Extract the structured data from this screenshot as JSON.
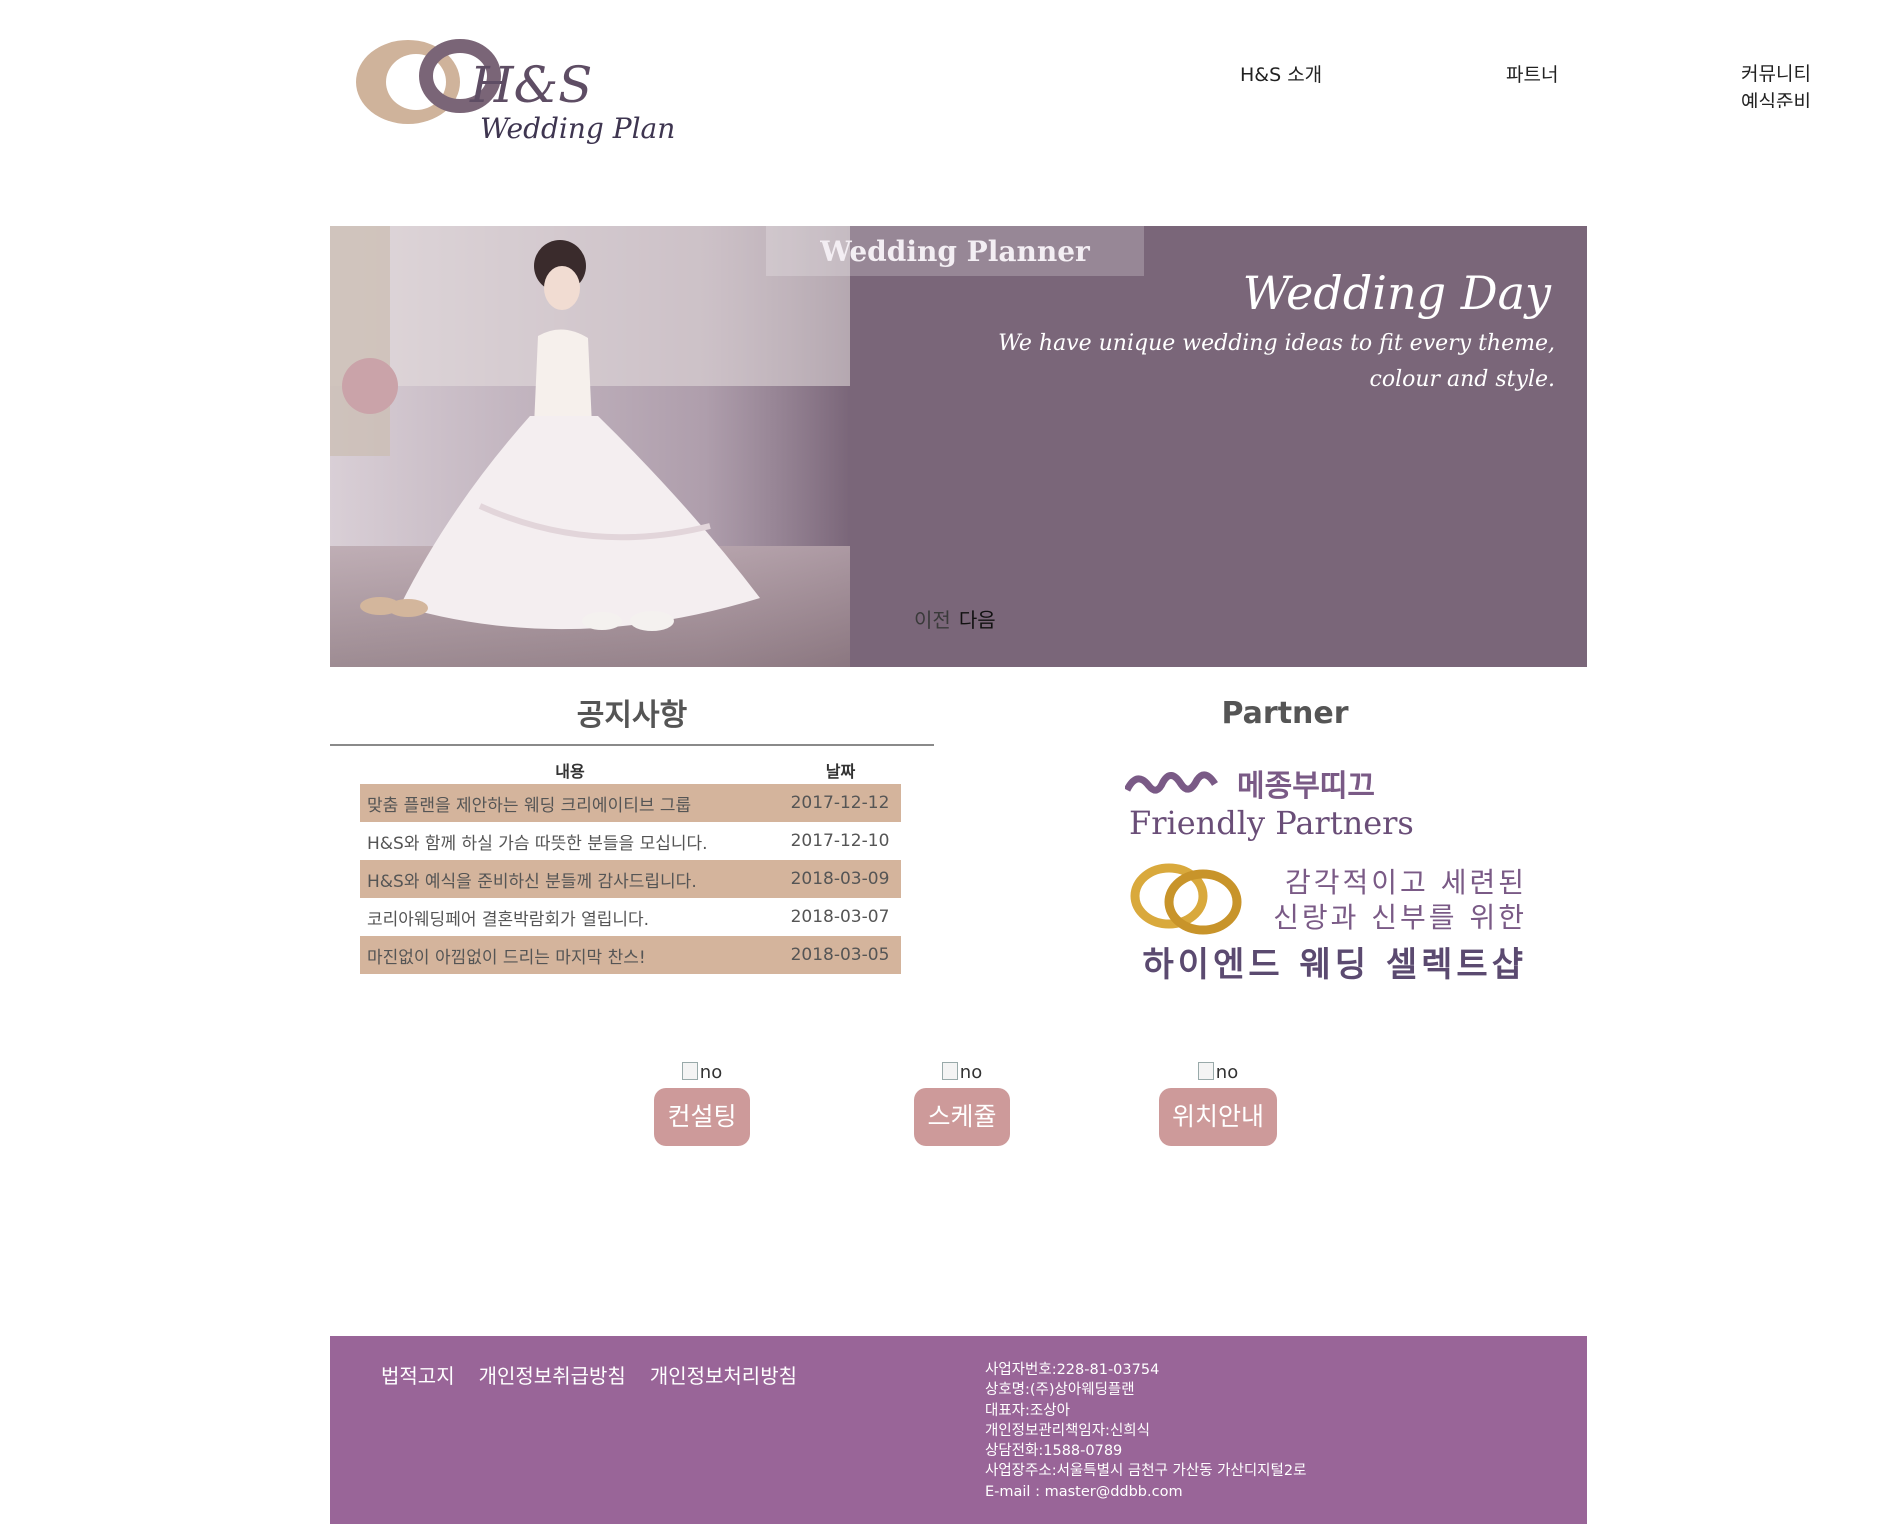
{
  "header": {
    "logo_mark": "H&S",
    "logo_tagline": "Wedding Plan",
    "nav": [
      "H&S 소개",
      "파트너",
      "커뮤니티",
      "예식준비"
    ]
  },
  "banner": {
    "tab_label": "Wedding Planner",
    "title": "Wedding Day",
    "subtitle_line1": "We have unique wedding ideas to fit every theme,",
    "subtitle_line2": "colour and style.",
    "prev_label": "이전",
    "next_label": "다음",
    "bg_color": "#7a6679"
  },
  "notice": {
    "title": "공지사항",
    "col_content": "내용",
    "col_date": "날짜",
    "rows": [
      {
        "content": "맞춤 플랜을 제안하는 웨딩 크리에이티브 그룹",
        "date": "2017-12-12"
      },
      {
        "content": "H&S와 함께 하실 가슴 따뜻한 분들을 모십니다.",
        "date": "2017-12-10"
      },
      {
        "content": "H&S와 예식을 준비하신 분들께 감사드립니다.",
        "date": "2018-03-09"
      },
      {
        "content": "코리아웨딩페어 결혼박람회가 열립니다.",
        "date": "2018-03-07"
      },
      {
        "content": "마진없이 아낌없이 드리는 마지막 찬스!",
        "date": "2018-03-05"
      }
    ],
    "row_highlight_color": "#d4b49c"
  },
  "partner": {
    "title": "Partner",
    "brand_ko": "메종부띠끄",
    "brand_en": "Friendly Partners",
    "slogan_line1": "감각적이고 세련된",
    "slogan_line2": "신랑과 신부를 위한",
    "slogan_line3": "하이엔드 웨딩 셀렉트샵"
  },
  "quick_buttons": [
    {
      "img_alt": "no",
      "label": "컨설팅"
    },
    {
      "img_alt": "no",
      "label": "스케쥴"
    },
    {
      "img_alt": "no",
      "label": "위치안내"
    }
  ],
  "footer": {
    "links": [
      "법적고지",
      "개인정보취급방침",
      "개인정보처리방침"
    ],
    "info": [
      "사업자번호:228-81-03754",
      "상호명:(주)상아웨딩플랜",
      "대표자:조상아",
      "개인정보관리책임자:신희식",
      "상담전화:1588-0789",
      "사업장주소:서울특별시 금천구 가산동 가산디지털2로",
      "E-mail : master@ddbb.com"
    ],
    "bg_color": "#996598"
  }
}
